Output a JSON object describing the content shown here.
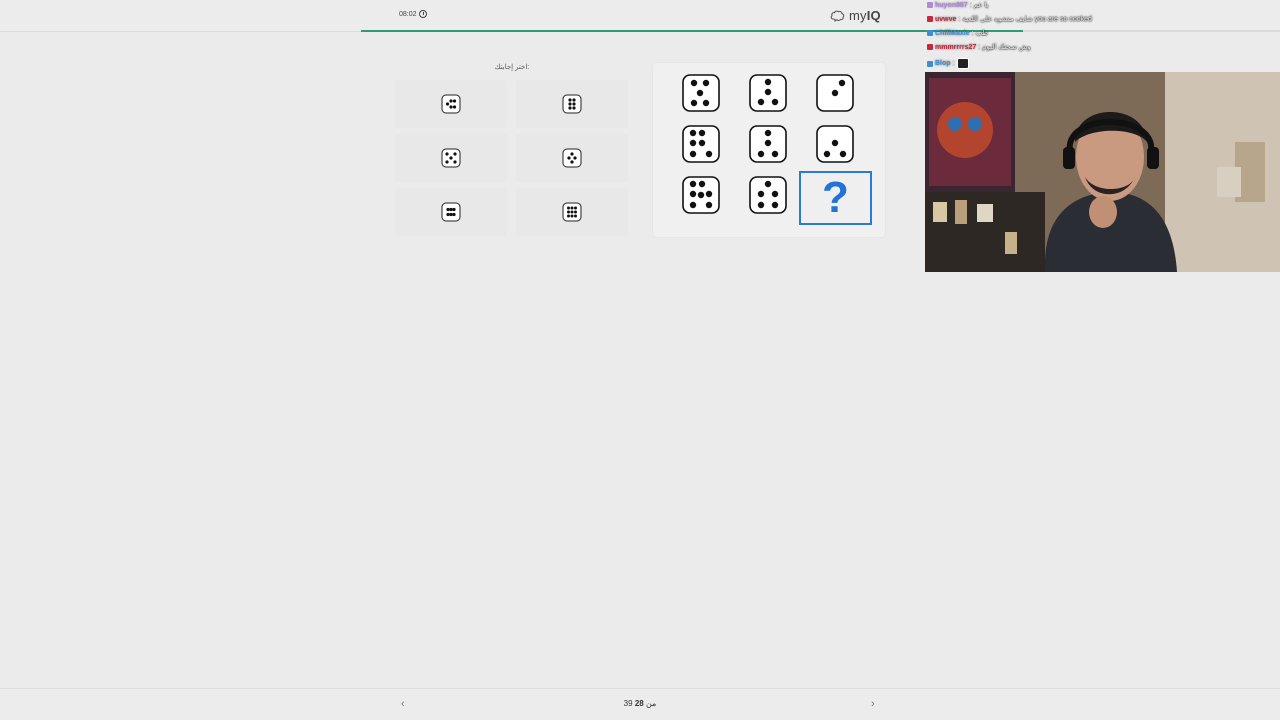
{
  "header": {
    "timer": "08:02",
    "brand": {
      "name_prefix": "my",
      "name_suffix": "IQ"
    },
    "progress_fraction": 0.72
  },
  "answers": {
    "title": "اختر إجابتك:",
    "options": [
      {
        "icon": "dice-face-icon"
      },
      {
        "icon": "dice-face-icon"
      },
      {
        "icon": "dice-face-icon"
      },
      {
        "icon": "dice-face-icon"
      },
      {
        "icon": "dice-face-icon"
      },
      {
        "icon": "dice-face-icon"
      }
    ]
  },
  "puzzle": {
    "question_mark": "?",
    "cells": [
      {
        "icon": "dice-face-icon"
      },
      {
        "icon": "dice-face-icon"
      },
      {
        "icon": "dice-face-icon"
      },
      {
        "icon": "dice-face-icon"
      },
      {
        "icon": "dice-face-icon"
      },
      {
        "icon": "dice-face-icon"
      },
      {
        "icon": "dice-face-icon"
      },
      {
        "icon": "dice-face-icon"
      }
    ]
  },
  "chat": {
    "messages": [
      {
        "user": "huyon887",
        "text": "يا عم",
        "color": "#b08ad8"
      },
      {
        "user": "uvwve",
        "text": "شايف متشوه على اللعبة you are so cooked",
        "color": "#c7283b"
      },
      {
        "user": "ChillMaxie",
        "text": "طب",
        "color": "#3a8fd8"
      },
      {
        "user": "mmmrrrrs27",
        "text": "وش صحتك اليوم",
        "color": "#c7283b"
      },
      {
        "user": "Blop",
        "text": "",
        "color": "#3a8fd8"
      }
    ]
  },
  "footer": {
    "prev_icon": "chevron-left-icon",
    "next_icon": "chevron-right-icon",
    "current": "28",
    "separator": "/",
    "total": "39",
    "counter_of": "من"
  },
  "colors": {
    "accent": "#2f9a73",
    "question_blue": "#2272d8"
  }
}
